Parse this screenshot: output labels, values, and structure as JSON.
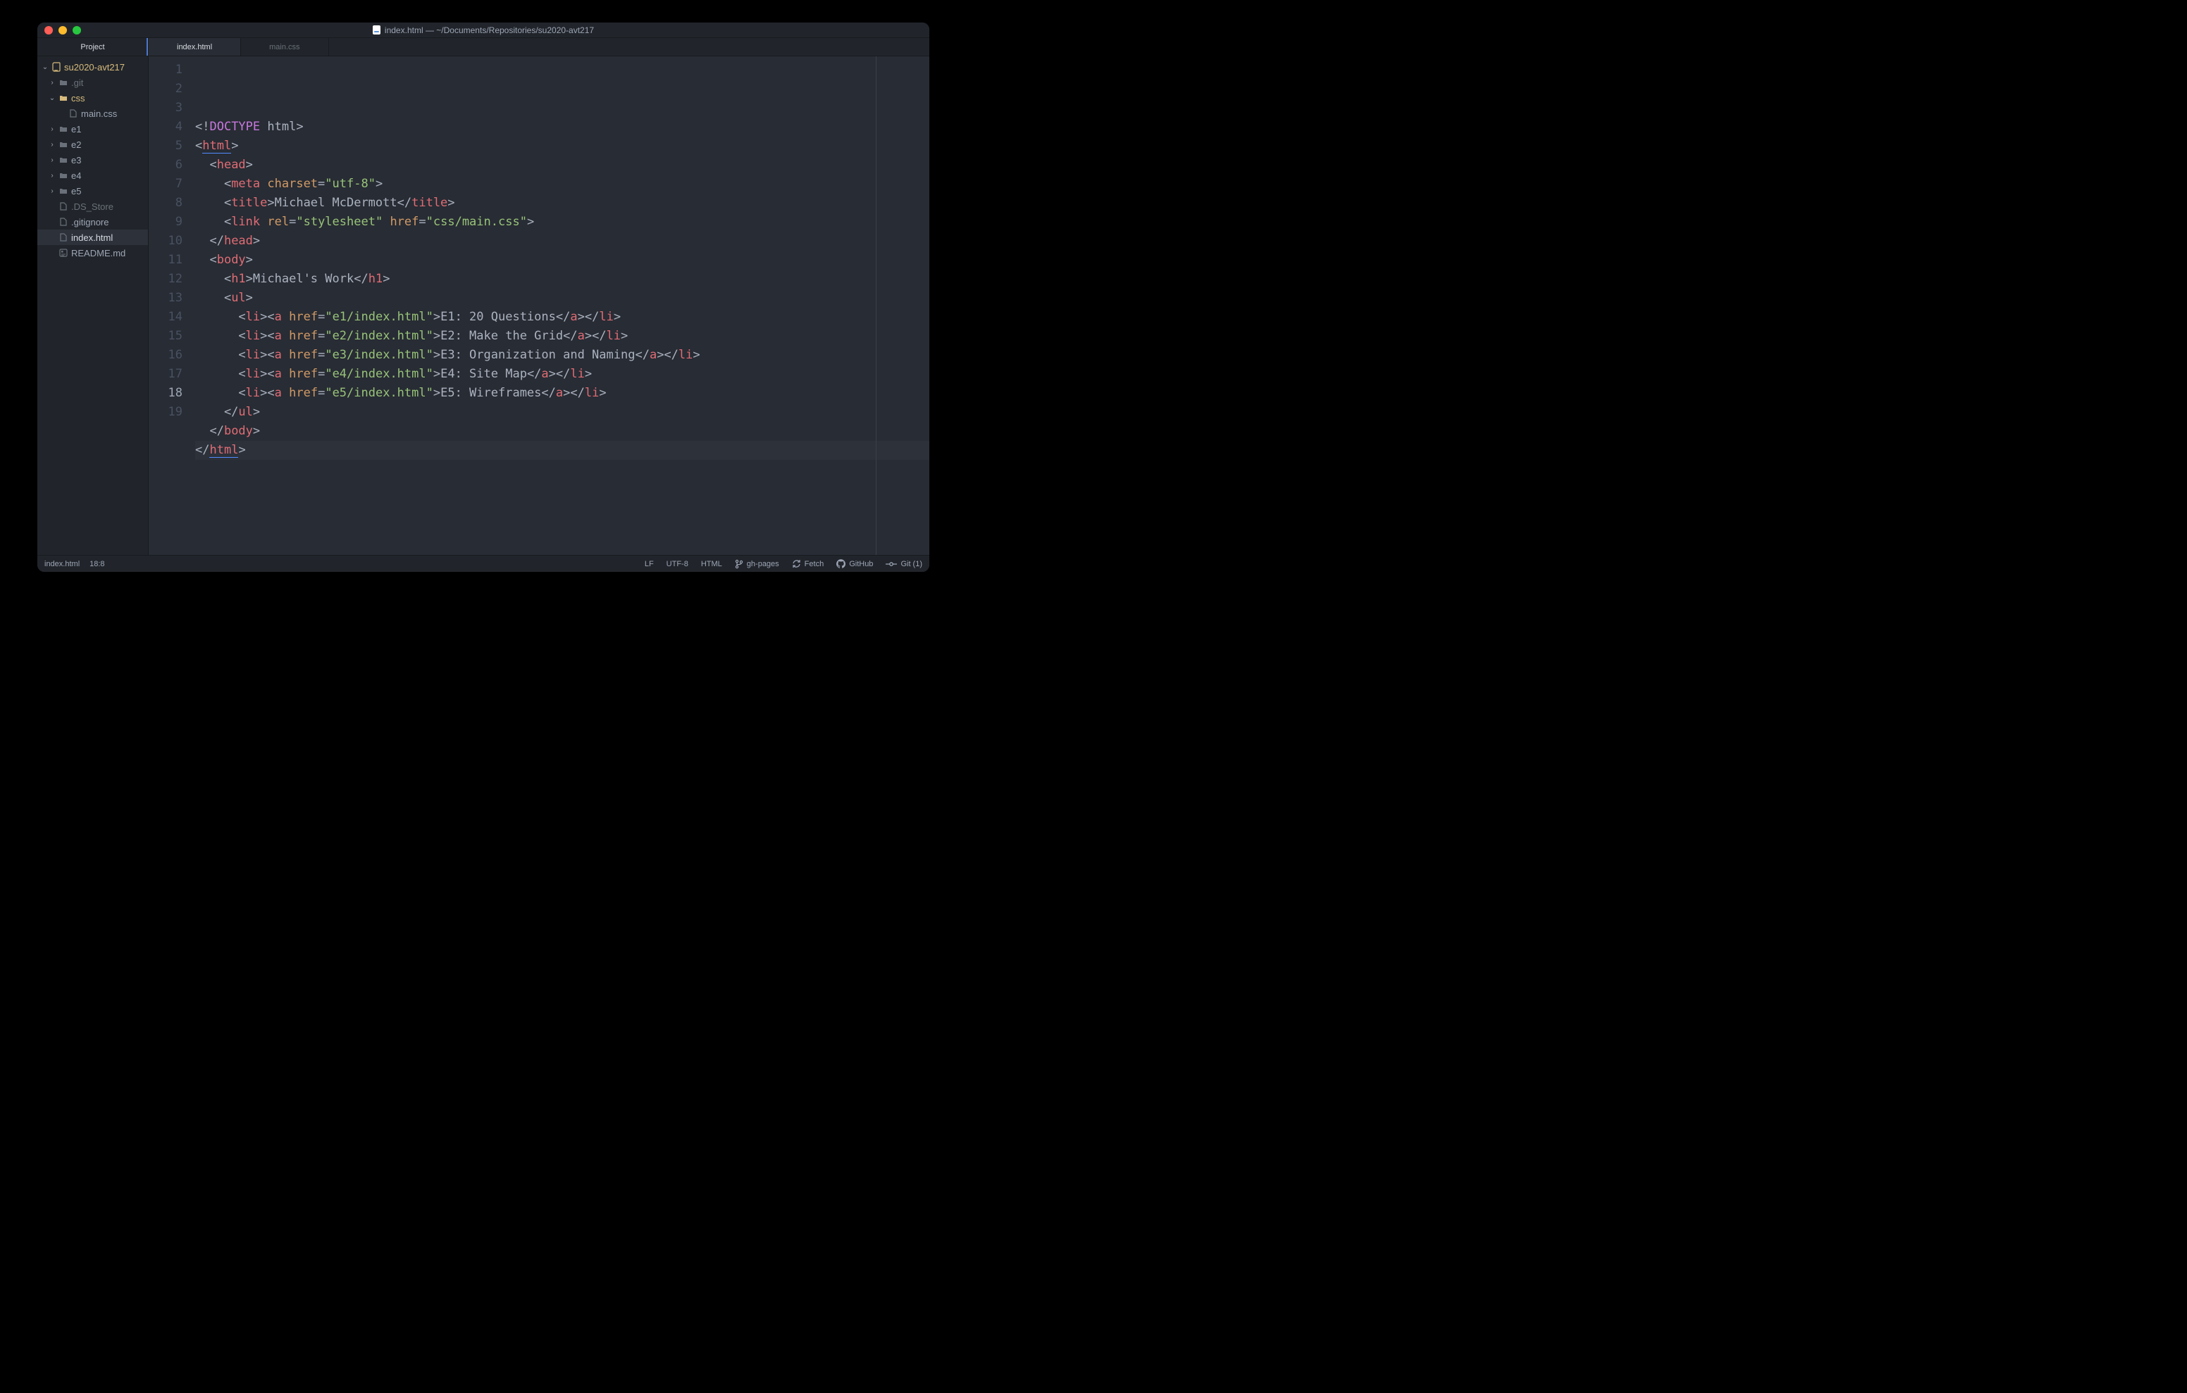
{
  "window": {
    "title": "index.html — ~/Documents/Repositories/su2020-avt217"
  },
  "sidebar": {
    "tab": "Project",
    "root": "su2020-avt217",
    "items": [
      {
        "label": ".git",
        "kind": "folder",
        "state": "collapsed",
        "indent": 1,
        "dim": true
      },
      {
        "label": "css",
        "kind": "folder",
        "state": "expanded",
        "indent": 1,
        "color": "amber"
      },
      {
        "label": "main.css",
        "kind": "file",
        "indent": 2
      },
      {
        "label": "e1",
        "kind": "folder",
        "state": "collapsed",
        "indent": 1
      },
      {
        "label": "e2",
        "kind": "folder",
        "state": "collapsed",
        "indent": 1
      },
      {
        "label": "e3",
        "kind": "folder",
        "state": "collapsed",
        "indent": 1
      },
      {
        "label": "e4",
        "kind": "folder",
        "state": "collapsed",
        "indent": 1
      },
      {
        "label": "e5",
        "kind": "folder",
        "state": "collapsed",
        "indent": 1
      },
      {
        "label": ".DS_Store",
        "kind": "file",
        "indent": 1,
        "dim": true
      },
      {
        "label": ".gitignore",
        "kind": "file",
        "indent": 1
      },
      {
        "label": "index.html",
        "kind": "file",
        "indent": 1,
        "selected": true
      },
      {
        "label": "README.md",
        "kind": "file",
        "indent": 1,
        "icon": "md"
      }
    ]
  },
  "tabs": [
    {
      "label": "index.html",
      "active": true
    },
    {
      "label": "main.css",
      "active": false
    }
  ],
  "linecount": 19,
  "current_line": 18,
  "code": [
    [
      {
        "t": "<!",
        "c": "pun"
      },
      {
        "t": "DOCTYPE",
        "c": "kw"
      },
      {
        "t": " html",
        "c": "pun"
      },
      {
        "t": ">",
        "c": "pun"
      }
    ],
    [
      {
        "t": "<",
        "c": "pun"
      },
      {
        "t": "html",
        "c": "tag html-underline"
      },
      {
        "t": ">",
        "c": "pun"
      }
    ],
    [
      {
        "t": "  <",
        "c": "pun"
      },
      {
        "t": "head",
        "c": "tag"
      },
      {
        "t": ">",
        "c": "pun"
      }
    ],
    [
      {
        "t": "    <",
        "c": "pun"
      },
      {
        "t": "meta",
        "c": "tag"
      },
      {
        "t": " ",
        "c": "pun"
      },
      {
        "t": "charset",
        "c": "attr"
      },
      {
        "t": "=",
        "c": "pun"
      },
      {
        "t": "\"utf-8\"",
        "c": "str"
      },
      {
        "t": ">",
        "c": "pun"
      }
    ],
    [
      {
        "t": "    <",
        "c": "pun"
      },
      {
        "t": "title",
        "c": "tag"
      },
      {
        "t": ">",
        "c": "pun"
      },
      {
        "t": "Michael McDermott",
        "c": "txt"
      },
      {
        "t": "</",
        "c": "pun"
      },
      {
        "t": "title",
        "c": "tag"
      },
      {
        "t": ">",
        "c": "pun"
      }
    ],
    [
      {
        "t": "    <",
        "c": "pun"
      },
      {
        "t": "link",
        "c": "tag"
      },
      {
        "t": " ",
        "c": "pun"
      },
      {
        "t": "rel",
        "c": "attr"
      },
      {
        "t": "=",
        "c": "pun"
      },
      {
        "t": "\"stylesheet\"",
        "c": "str"
      },
      {
        "t": " ",
        "c": "pun"
      },
      {
        "t": "href",
        "c": "attr"
      },
      {
        "t": "=",
        "c": "pun"
      },
      {
        "t": "\"css/main.css\"",
        "c": "str"
      },
      {
        "t": ">",
        "c": "pun"
      }
    ],
    [
      {
        "t": "  </",
        "c": "pun"
      },
      {
        "t": "head",
        "c": "tag"
      },
      {
        "t": ">",
        "c": "pun"
      }
    ],
    [
      {
        "t": "  <",
        "c": "pun"
      },
      {
        "t": "body",
        "c": "tag"
      },
      {
        "t": ">",
        "c": "pun"
      }
    ],
    [
      {
        "t": "    <",
        "c": "pun"
      },
      {
        "t": "h1",
        "c": "tag"
      },
      {
        "t": ">",
        "c": "pun"
      },
      {
        "t": "Michael's Work",
        "c": "txt"
      },
      {
        "t": "</",
        "c": "pun"
      },
      {
        "t": "h1",
        "c": "tag"
      },
      {
        "t": ">",
        "c": "pun"
      }
    ],
    [
      {
        "t": "    <",
        "c": "pun"
      },
      {
        "t": "ul",
        "c": "tag"
      },
      {
        "t": ">",
        "c": "pun"
      }
    ],
    [
      {
        "t": "      <",
        "c": "pun"
      },
      {
        "t": "li",
        "c": "tag"
      },
      {
        "t": "><",
        "c": "pun"
      },
      {
        "t": "a",
        "c": "tag"
      },
      {
        "t": " ",
        "c": "pun"
      },
      {
        "t": "href",
        "c": "attr"
      },
      {
        "t": "=",
        "c": "pun"
      },
      {
        "t": "\"e1/index.html\"",
        "c": "str"
      },
      {
        "t": ">",
        "c": "pun"
      },
      {
        "t": "E1: 20 Questions",
        "c": "txt"
      },
      {
        "t": "</",
        "c": "pun"
      },
      {
        "t": "a",
        "c": "tag"
      },
      {
        "t": "></",
        "c": "pun"
      },
      {
        "t": "li",
        "c": "tag"
      },
      {
        "t": ">",
        "c": "pun"
      }
    ],
    [
      {
        "t": "      <",
        "c": "pun"
      },
      {
        "t": "li",
        "c": "tag"
      },
      {
        "t": "><",
        "c": "pun"
      },
      {
        "t": "a",
        "c": "tag"
      },
      {
        "t": " ",
        "c": "pun"
      },
      {
        "t": "href",
        "c": "attr"
      },
      {
        "t": "=",
        "c": "pun"
      },
      {
        "t": "\"e2/index.html\"",
        "c": "str"
      },
      {
        "t": ">",
        "c": "pun"
      },
      {
        "t": "E2: Make the Grid",
        "c": "txt"
      },
      {
        "t": "</",
        "c": "pun"
      },
      {
        "t": "a",
        "c": "tag"
      },
      {
        "t": "></",
        "c": "pun"
      },
      {
        "t": "li",
        "c": "tag"
      },
      {
        "t": ">",
        "c": "pun"
      }
    ],
    [
      {
        "t": "      <",
        "c": "pun"
      },
      {
        "t": "li",
        "c": "tag"
      },
      {
        "t": "><",
        "c": "pun"
      },
      {
        "t": "a",
        "c": "tag"
      },
      {
        "t": " ",
        "c": "pun"
      },
      {
        "t": "href",
        "c": "attr"
      },
      {
        "t": "=",
        "c": "pun"
      },
      {
        "t": "\"e3/index.html\"",
        "c": "str"
      },
      {
        "t": ">",
        "c": "pun"
      },
      {
        "t": "E3: Organization and Naming",
        "c": "txt"
      },
      {
        "t": "</",
        "c": "pun"
      },
      {
        "t": "a",
        "c": "tag"
      },
      {
        "t": "></",
        "c": "pun"
      },
      {
        "t": "li",
        "c": "tag"
      },
      {
        "t": ">",
        "c": "pun"
      }
    ],
    [
      {
        "t": "      <",
        "c": "pun"
      },
      {
        "t": "li",
        "c": "tag"
      },
      {
        "t": "><",
        "c": "pun"
      },
      {
        "t": "a",
        "c": "tag"
      },
      {
        "t": " ",
        "c": "pun"
      },
      {
        "t": "href",
        "c": "attr"
      },
      {
        "t": "=",
        "c": "pun"
      },
      {
        "t": "\"e4/index.html\"",
        "c": "str"
      },
      {
        "t": ">",
        "c": "pun"
      },
      {
        "t": "E4: Site Map",
        "c": "txt"
      },
      {
        "t": "</",
        "c": "pun"
      },
      {
        "t": "a",
        "c": "tag"
      },
      {
        "t": "></",
        "c": "pun"
      },
      {
        "t": "li",
        "c": "tag"
      },
      {
        "t": ">",
        "c": "pun"
      }
    ],
    [
      {
        "t": "      <",
        "c": "pun"
      },
      {
        "t": "li",
        "c": "tag"
      },
      {
        "t": "><",
        "c": "pun"
      },
      {
        "t": "a",
        "c": "tag"
      },
      {
        "t": " ",
        "c": "pun"
      },
      {
        "t": "href",
        "c": "attr"
      },
      {
        "t": "=",
        "c": "pun"
      },
      {
        "t": "\"e5/index.html\"",
        "c": "str"
      },
      {
        "t": ">",
        "c": "pun"
      },
      {
        "t": "E5: Wireframes",
        "c": "txt"
      },
      {
        "t": "</",
        "c": "pun"
      },
      {
        "t": "a",
        "c": "tag"
      },
      {
        "t": "></",
        "c": "pun"
      },
      {
        "t": "li",
        "c": "tag"
      },
      {
        "t": ">",
        "c": "pun"
      }
    ],
    [
      {
        "t": "    </",
        "c": "pun"
      },
      {
        "t": "ul",
        "c": "tag"
      },
      {
        "t": ">",
        "c": "pun"
      }
    ],
    [
      {
        "t": "  </",
        "c": "pun"
      },
      {
        "t": "body",
        "c": "tag"
      },
      {
        "t": ">",
        "c": "pun"
      }
    ],
    [
      {
        "t": "</",
        "c": "pun"
      },
      {
        "t": "html",
        "c": "tag html-underline"
      },
      {
        "t": ">",
        "c": "pun"
      }
    ],
    []
  ],
  "status": {
    "file": "index.html",
    "cursor": "18:8",
    "eol": "LF",
    "encoding": "UTF-8",
    "grammar": "HTML",
    "branch": "gh-pages",
    "fetch": "Fetch",
    "github": "GitHub",
    "git": "Git (1)"
  }
}
